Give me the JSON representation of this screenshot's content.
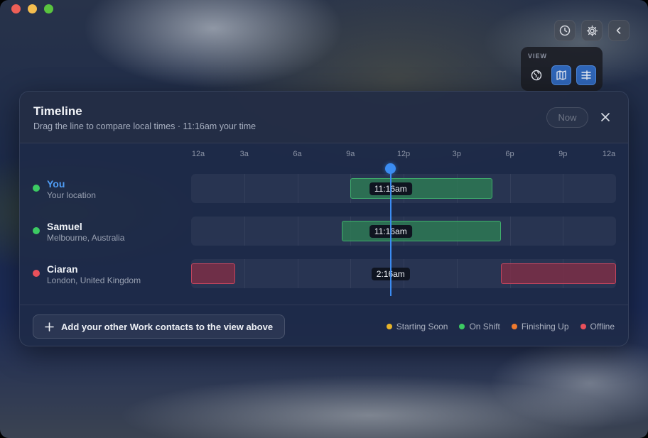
{
  "app": {
    "tools": [
      {
        "name": "clock-icon"
      },
      {
        "name": "gear-icon"
      },
      {
        "name": "chevron-left-icon"
      }
    ]
  },
  "view_panel": {
    "label": "VIEW",
    "options": [
      {
        "name": "globe-icon",
        "active": false
      },
      {
        "name": "map-icon",
        "active": true
      },
      {
        "name": "timeline-icon",
        "active": true
      }
    ]
  },
  "timeline": {
    "title": "Timeline",
    "subtitle": "Drag the line to compare local times · 11:16am your time",
    "now_label": "Now",
    "ticks": [
      "12a",
      "3a",
      "6a",
      "9a",
      "12p",
      "3p",
      "6p",
      "9p",
      "12a"
    ],
    "cursor_hour": 11.27,
    "rows": [
      {
        "name": "You",
        "location": "Your location",
        "status": "on-shift",
        "time": "11:16am",
        "shifts": [
          [
            9,
            17
          ]
        ],
        "status_color": "#3ccb63"
      },
      {
        "name": "Samuel",
        "location": "Melbourne, Australia",
        "status": "on-shift",
        "time": "11:16am",
        "shifts": [
          [
            8.5,
            17.5
          ]
        ],
        "status_color": "#3ccb63"
      },
      {
        "name": "Ciaran",
        "location": "London, United Kingdom",
        "status": "offline",
        "time": "2:16am",
        "shifts": [
          [
            0,
            2.5
          ],
          [
            17.5,
            24
          ]
        ],
        "status_color": "#e9505b"
      }
    ]
  },
  "footer": {
    "add_label": "Add your other Work contacts to the view above",
    "legend": [
      {
        "label": "Starting Soon",
        "color": "#e8b429"
      },
      {
        "label": "On Shift",
        "color": "#3ccb63"
      },
      {
        "label": "Finishing Up",
        "color": "#ee7a2e"
      },
      {
        "label": "Offline",
        "color": "#e9505b"
      }
    ]
  }
}
